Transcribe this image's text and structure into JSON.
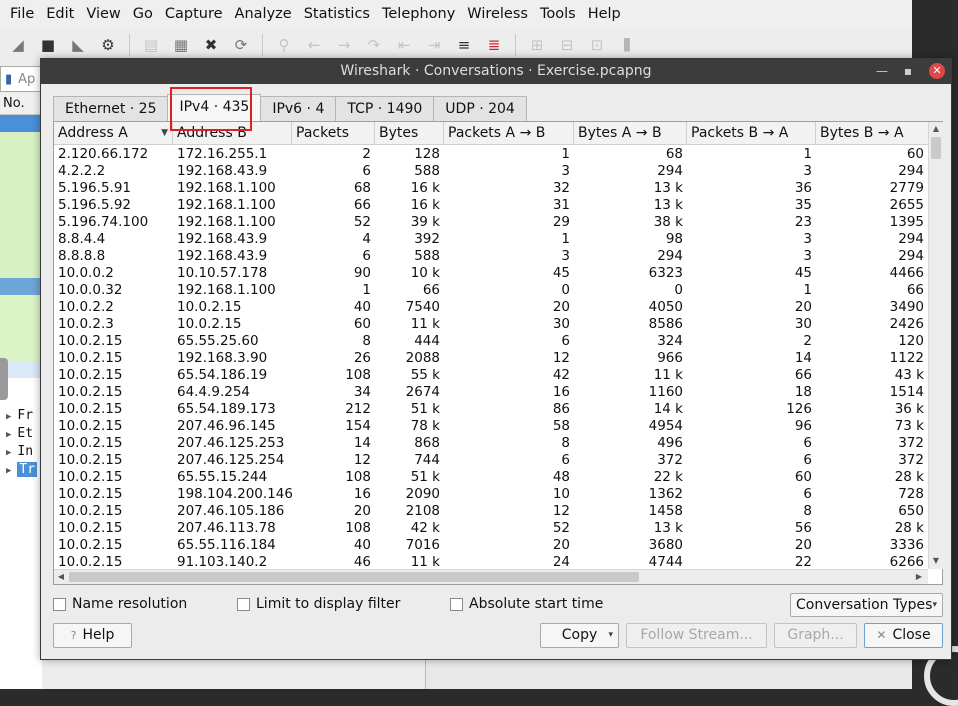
{
  "main_window": {
    "menu": [
      "File",
      "Edit",
      "View",
      "Go",
      "Capture",
      "Analyze",
      "Statistics",
      "Telephony",
      "Wireless",
      "Tools",
      "Help"
    ],
    "filter_text": "Ap",
    "packet_list_column": "No.",
    "detail_rows": [
      "Fr",
      "Et",
      "In",
      "Tr"
    ]
  },
  "dialog": {
    "title": "Wireshark · Conversations · Exercise.pcapng",
    "tabs": [
      "Ethernet · 25",
      "IPv4 · 435",
      "IPv6 · 4",
      "TCP · 1490",
      "UDP · 204"
    ],
    "active_tab": "IPv4 · 435",
    "columns": [
      "Address A",
      "Address B",
      "Packets",
      "Bytes",
      "Packets A → B",
      "Bytes A → B",
      "Packets B → A",
      "Bytes B → A"
    ],
    "rows": [
      [
        "2.120.66.172",
        "172.16.255.1",
        "2",
        "128",
        "1",
        "68",
        "1",
        "60"
      ],
      [
        "4.2.2.2",
        "192.168.43.9",
        "6",
        "588",
        "3",
        "294",
        "3",
        "294"
      ],
      [
        "5.196.5.91",
        "192.168.1.100",
        "68",
        "16 k",
        "32",
        "13 k",
        "36",
        "2779"
      ],
      [
        "5.196.5.92",
        "192.168.1.100",
        "66",
        "16 k",
        "31",
        "13 k",
        "35",
        "2655"
      ],
      [
        "5.196.74.100",
        "192.168.1.100",
        "52",
        "39 k",
        "29",
        "38 k",
        "23",
        "1395"
      ],
      [
        "8.8.4.4",
        "192.168.43.9",
        "4",
        "392",
        "1",
        "98",
        "3",
        "294"
      ],
      [
        "8.8.8.8",
        "192.168.43.9",
        "6",
        "588",
        "3",
        "294",
        "3",
        "294"
      ],
      [
        "10.0.0.2",
        "10.10.57.178",
        "90",
        "10 k",
        "45",
        "6323",
        "45",
        "4466"
      ],
      [
        "10.0.0.32",
        "192.168.1.100",
        "1",
        "66",
        "0",
        "0",
        "1",
        "66"
      ],
      [
        "10.0.2.2",
        "10.0.2.15",
        "40",
        "7540",
        "20",
        "4050",
        "20",
        "3490"
      ],
      [
        "10.0.2.3",
        "10.0.2.15",
        "60",
        "11 k",
        "30",
        "8586",
        "30",
        "2426"
      ],
      [
        "10.0.2.15",
        "65.55.25.60",
        "8",
        "444",
        "6",
        "324",
        "2",
        "120"
      ],
      [
        "10.0.2.15",
        "192.168.3.90",
        "26",
        "2088",
        "12",
        "966",
        "14",
        "1122"
      ],
      [
        "10.0.2.15",
        "65.54.186.19",
        "108",
        "55 k",
        "42",
        "11 k",
        "66",
        "43 k"
      ],
      [
        "10.0.2.15",
        "64.4.9.254",
        "34",
        "2674",
        "16",
        "1160",
        "18",
        "1514"
      ],
      [
        "10.0.2.15",
        "65.54.189.173",
        "212",
        "51 k",
        "86",
        "14 k",
        "126",
        "36 k"
      ],
      [
        "10.0.2.15",
        "207.46.96.145",
        "154",
        "78 k",
        "58",
        "4954",
        "96",
        "73 k"
      ],
      [
        "10.0.2.15",
        "207.46.125.253",
        "14",
        "868",
        "8",
        "496",
        "6",
        "372"
      ],
      [
        "10.0.2.15",
        "207.46.125.254",
        "12",
        "744",
        "6",
        "372",
        "6",
        "372"
      ],
      [
        "10.0.2.15",
        "65.55.15.244",
        "108",
        "51 k",
        "48",
        "22 k",
        "60",
        "28 k"
      ],
      [
        "10.0.2.15",
        "198.104.200.146",
        "16",
        "2090",
        "10",
        "1362",
        "6",
        "728"
      ],
      [
        "10.0.2.15",
        "207.46.105.186",
        "20",
        "2108",
        "12",
        "1458",
        "8",
        "650"
      ],
      [
        "10.0.2.15",
        "207.46.113.78",
        "108",
        "42 k",
        "52",
        "13 k",
        "56",
        "28 k"
      ],
      [
        "10.0.2.15",
        "65.55.116.184",
        "40",
        "7016",
        "20",
        "3680",
        "20",
        "3336"
      ],
      [
        "10.0.2.15",
        "91.103.140.2",
        "46",
        "11 k",
        "24",
        "4744",
        "22",
        "6266"
      ]
    ],
    "options": {
      "name_resolution": "Name resolution",
      "limit_filter": "Limit to display filter",
      "absolute_time": "Absolute start time",
      "conv_types": "Conversation Types"
    },
    "buttons": {
      "help": "Help",
      "copy": "Copy",
      "follow": "Follow Stream...",
      "graph": "Graph...",
      "close": "Close"
    }
  },
  "colors": {
    "highlight_box": "#e02020",
    "selection": "#4a90d9",
    "packet_green": "#d6f2c2"
  }
}
